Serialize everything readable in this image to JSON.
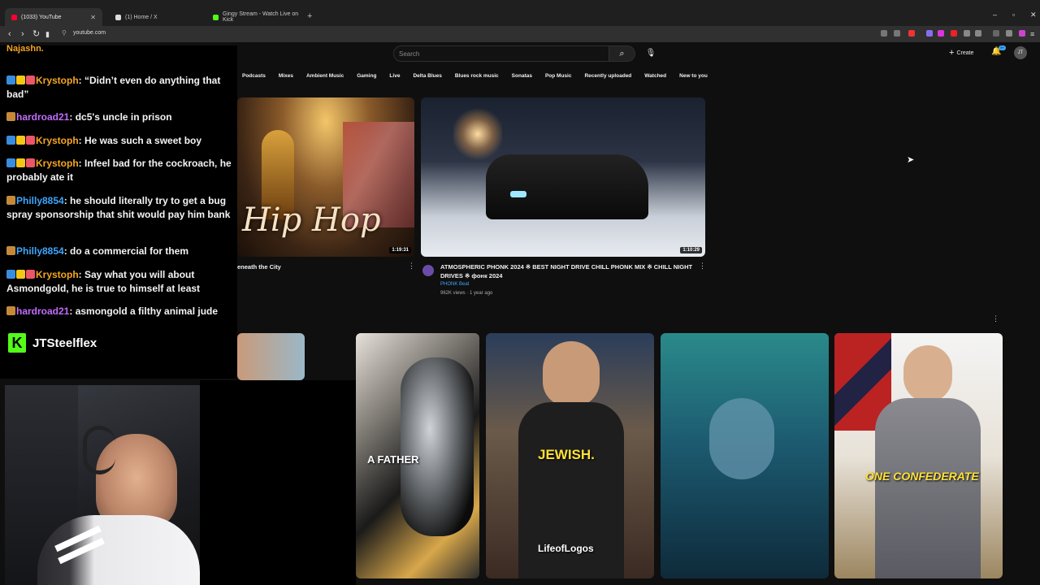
{
  "browser": {
    "tabs": [
      {
        "title": "(1033) YouTube",
        "active": true,
        "color": "#ff0033"
      },
      {
        "title": "(1) Home / X",
        "active": false,
        "color": "#ffffff"
      },
      {
        "title": "Gingy Stream - Watch Live on Kick",
        "active": false,
        "color": "#53fc18"
      }
    ],
    "url": "youtube.com"
  },
  "youtube": {
    "search_placeholder": "Search",
    "create_label": "Create",
    "notification_count": "9+",
    "avatar_initials": "JT",
    "chips": [
      "Podcasts",
      "Mixes",
      "Ambient Music",
      "Gaming",
      "Live",
      "Delta Blues",
      "Blues rock music",
      "Sonatas",
      "Pop Music",
      "Recently uploaded",
      "Watched",
      "New to you"
    ],
    "videos": [
      {
        "thumb_text": "Hip Hop",
        "duration": "1:19:31",
        "title": "eneath the City"
      },
      {
        "duration": "1:10:29",
        "title": "ATMOSPHERIC PHONK 2024 ※ BEST NIGHT DRIVE CHILL PHONK MIX ※ CHILL NIGHT DRIVES ※ фонк 2024",
        "channel": "PHONK Beat",
        "meta": "962K views · 1 year ago"
      }
    ],
    "shorts": [
      {
        "caption": "A FATHER"
      },
      {
        "caption": "JEWISH.",
        "watermark": "LifeofLogos"
      },
      {
        "caption": ""
      },
      {
        "caption": "ONE CONFEDERATE"
      }
    ]
  },
  "chat": {
    "top_partial": "Najashn.",
    "messages": [
      {
        "user": "Krystoph",
        "text": ": “Didn’t even do anything that bad”",
        "color": "orange",
        "badges": 3
      },
      {
        "user": "hardroad21",
        "text": ": dc5's uncle in prison",
        "color": "purple",
        "badges": 1
      },
      {
        "user": "Krystoph",
        "text": ": He was such a sweet boy",
        "color": "orange",
        "badges": 3
      },
      {
        "user": "Krystoph",
        "text": ": Infeel bad for the cockroach, he probably ate it",
        "color": "orange",
        "badges": 3
      },
      {
        "user": "Philly8854",
        "text": ": he should literally try to get a bug spray sponsorship that shit would pay him bank",
        "color": "blue",
        "badges": 1
      },
      {
        "user": "Philly8854",
        "text": ": do a commercial for them",
        "color": "blue",
        "badges": 1
      },
      {
        "user": "Krystoph",
        "text": ": Say what you will about Asmondgold, he is true to himself at least",
        "color": "orange",
        "badges": 3
      },
      {
        "user": "hardroad21",
        "text": ": asmongold a filthy animal jude",
        "color": "purple",
        "badges": 1
      }
    ],
    "streamer_name": "JTSteelflex"
  }
}
